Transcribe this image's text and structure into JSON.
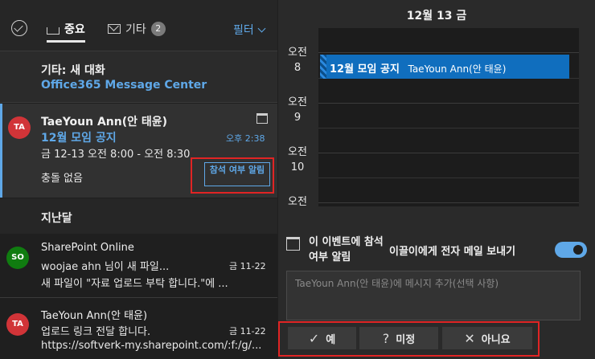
{
  "tabs": {
    "focused": "중요",
    "other": "기타",
    "other_count": "2",
    "filter": "필터"
  },
  "other_inbox": {
    "title": "기타: 새 대화",
    "sender": "Office365 Message Center"
  },
  "selected_mail": {
    "avatar": "TA",
    "from": "TaeYoun Ann(안 태윤)",
    "subject": "12월 모임 공지",
    "time": "오후 2:38",
    "when": "금 12-13 오전 8:00 - 오전 8:30",
    "conflict": "충돌 없음",
    "rsvp_button": "참석 여부 알림"
  },
  "section_label": "지난달",
  "mails": [
    {
      "avatar": "SO",
      "from": "SharePoint Online",
      "line2": "woojae ahn 님이 새 파일...",
      "date": "금 11-22",
      "preview": "새 파일이 \"자료 업로드 부탁 합니다.\"에 ..."
    },
    {
      "avatar": "TA",
      "from": "TaeYoun Ann(안 태윤)",
      "line2": "업로드 링크 전달 합니다.",
      "date": "금 11-22",
      "preview": "https://softverk-my.sharepoint.com/:f:/g/..."
    }
  ],
  "calendar": {
    "day": "12월 13 금",
    "hours": [
      {
        "ampm": "오전",
        "hour": "8"
      },
      {
        "ampm": "오전",
        "hour": "9"
      },
      {
        "ampm": "오전",
        "hour": "10"
      },
      {
        "ampm": "오전",
        "hour": ""
      }
    ],
    "event_title": "12월 모임 공지",
    "event_organizer": "TaeYoun Ann(안 태윤)"
  },
  "rsvp_panel": {
    "label": "이 이벤트에 참석 여부 알림",
    "send_label": "이끌이에게 전자 메일 보내기",
    "send_enabled": true,
    "message_placeholder": "TaeYoun Ann(안 태윤)에 메시지 추가(선택 사항)",
    "accept": "예",
    "tentative": "미정",
    "decline": "아니요"
  },
  "colors": {
    "accent": "#5fa8e8",
    "event": "#106ebe",
    "highlight": "#e02424"
  }
}
